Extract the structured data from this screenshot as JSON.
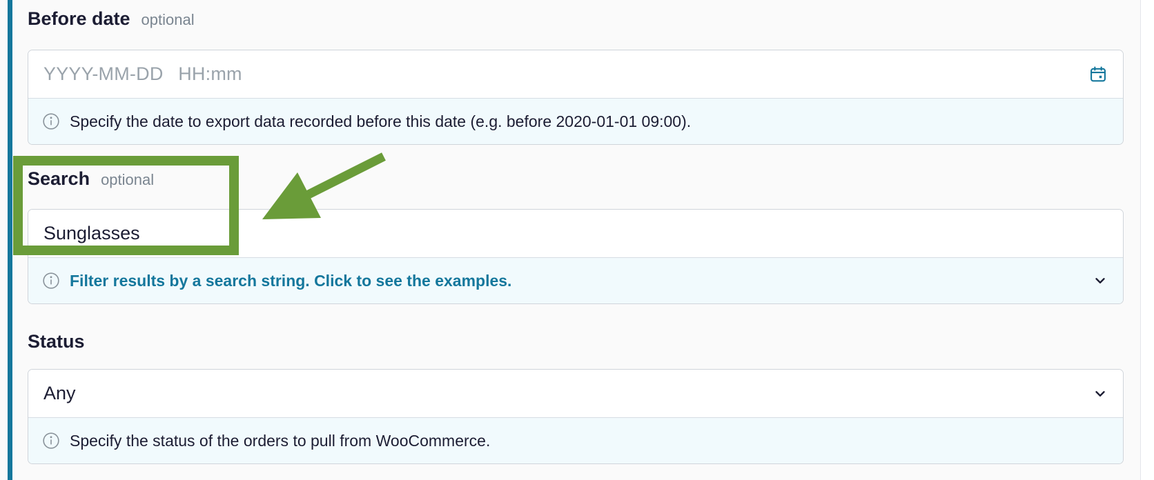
{
  "form": {
    "before_date": {
      "label": "Before date",
      "optional": "optional",
      "placeholder": "YYYY-MM-DD HH:mm",
      "hint": "Specify the date to export data recorded before this date (e.g. before 2020-01-01 09:00)."
    },
    "search": {
      "label": "Search",
      "optional": "optional",
      "value": "Sunglasses",
      "hint": "Filter results by a search string. Click to see the examples."
    },
    "status": {
      "label": "Status",
      "value": "Any",
      "hint": "Specify the status of the orders to pull from WooCommerce."
    }
  },
  "colors": {
    "accent": "#14779c",
    "annotation": "#6a9c39",
    "hint_background": "#f1fafd"
  },
  "icons": [
    "calendar-icon",
    "info-icon",
    "chevron-down-icon"
  ]
}
